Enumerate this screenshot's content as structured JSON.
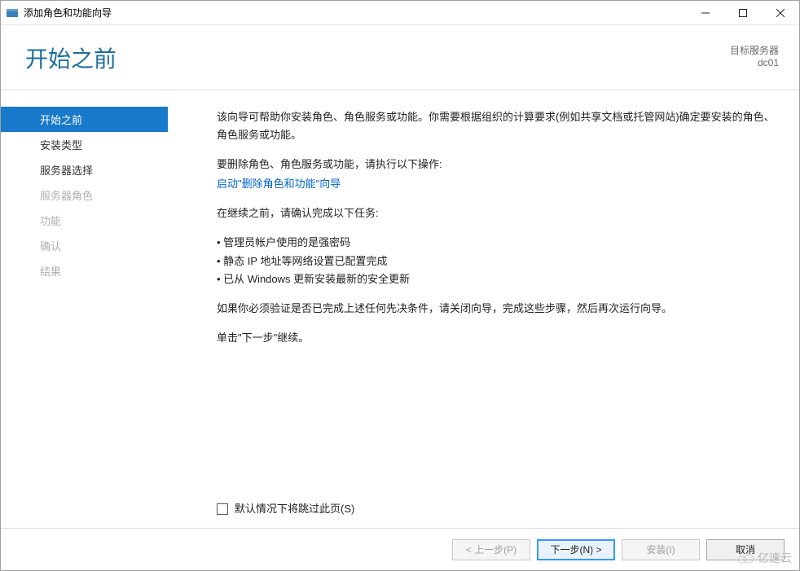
{
  "window": {
    "title": "添加角色和功能向导"
  },
  "header": {
    "title": "开始之前",
    "target_label": "目标服务器",
    "target_name": "dc01"
  },
  "sidebar": {
    "items": [
      {
        "label": "开始之前",
        "state": "active"
      },
      {
        "label": "安装类型",
        "state": "enabled"
      },
      {
        "label": "服务器选择",
        "state": "enabled"
      },
      {
        "label": "服务器角色",
        "state": "disabled"
      },
      {
        "label": "功能",
        "state": "disabled"
      },
      {
        "label": "确认",
        "state": "disabled"
      },
      {
        "label": "结果",
        "state": "disabled"
      }
    ]
  },
  "content": {
    "intro": "该向导可帮助你安装角色、角色服务或功能。你需要根据组织的计算要求(例如共享文档或托管网站)确定要安装的角色、角色服务或功能。",
    "remove_intro": "要删除角色、角色服务或功能，请执行以下操作:",
    "remove_link": "启动\"删除角色和功能\"向导",
    "precheck_title": "在继续之前，请确认完成以下任务:",
    "bullets": [
      "管理员帐户使用的是强密码",
      "静态 IP 地址等网络设置已配置完成",
      "已从 Windows 更新安装最新的安全更新"
    ],
    "verify_note": "如果你必须验证是否已完成上述任何先决条件，请关闭向导，完成这些步骤，然后再次运行向导。",
    "continue_note": "单击\"下一步\"继续。",
    "skip_checkbox": "默认情况下将跳过此页(S)"
  },
  "footer": {
    "previous": "< 上一步(P)",
    "next": "下一步(N) >",
    "install": "安装(I)",
    "cancel": "取消"
  },
  "watermark": "亿速云"
}
